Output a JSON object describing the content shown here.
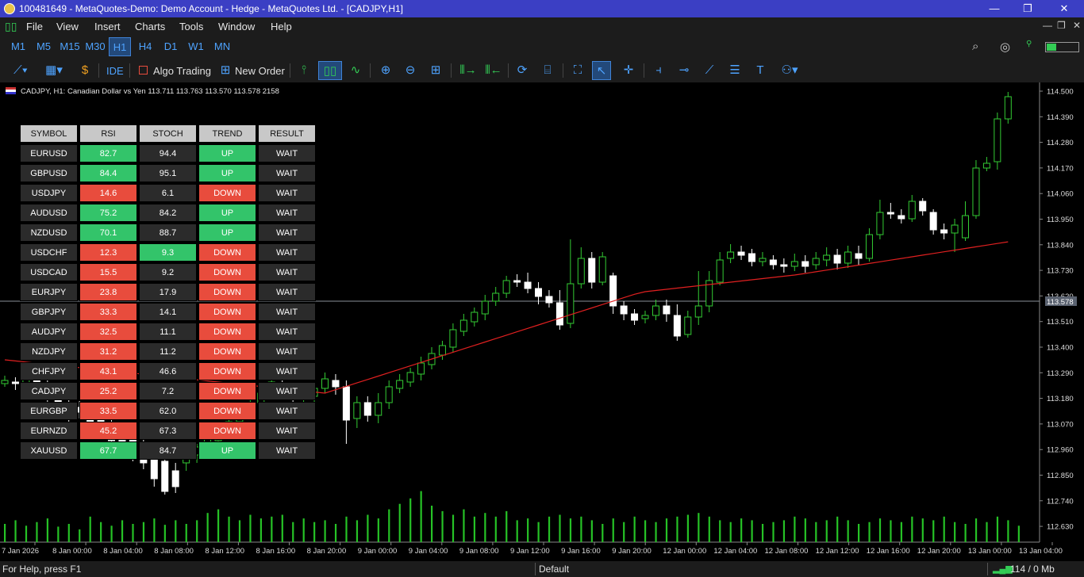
{
  "window": {
    "title": "100481649 - MetaQuotes-Demo: Demo Account - Hedge - MetaQuotes Ltd. - [CADJPY,H1]",
    "minimize": "—",
    "maximize": "❐",
    "close": "✕"
  },
  "menu": {
    "items": [
      "File",
      "View",
      "Insert",
      "Charts",
      "Tools",
      "Window",
      "Help"
    ]
  },
  "timeframes": {
    "items": [
      "M1",
      "M5",
      "M15",
      "M30",
      "H1",
      "H4",
      "D1",
      "W1",
      "MN"
    ],
    "active": "H1"
  },
  "toolbar": {
    "ide": "IDE",
    "algo_trading": "Algo Trading",
    "new_order": "New Order"
  },
  "chart": {
    "info": "CADJPY, H1:  Canadian Dollar vs Yen  113.711 113.763 113.570 113.578  2158",
    "current_price": "113.578",
    "y_ticks": [
      "114.500",
      "114.390",
      "114.280",
      "114.170",
      "114.060",
      "113.950",
      "113.840",
      "113.730",
      "113.620",
      "113.510",
      "113.400",
      "113.290",
      "113.180",
      "113.070",
      "112.960",
      "112.850",
      "112.740",
      "112.630"
    ],
    "x_ticks": [
      "7 Jan 2026",
      "8 Jan 00:00",
      "8 Jan 04:00",
      "8 Jan 08:00",
      "8 Jan 12:00",
      "8 Jan 16:00",
      "8 Jan 20:00",
      "9 Jan 00:00",
      "9 Jan 04:00",
      "9 Jan 08:00",
      "9 Jan 12:00",
      "9 Jan 16:00",
      "9 Jan 20:00",
      "12 Jan 00:00",
      "12 Jan 04:00",
      "12 Jan 08:00",
      "12 Jan 12:00",
      "12 Jan 16:00",
      "12 Jan 20:00",
      "13 Jan 00:00",
      "13 Jan 04:00"
    ],
    "colors": {
      "bull": "#33cc33",
      "bear": "#ffffff",
      "ma": "#e02020",
      "volume": "#26c226",
      "grid": "#555555"
    }
  },
  "dashboard": {
    "headers": [
      "SYMBOL",
      "RSI",
      "STOCH",
      "TREND",
      "RESULT"
    ],
    "rows": [
      [
        "EURUSD",
        "82.7",
        "94.4",
        "UP",
        "WAIT"
      ],
      [
        "GBPUSD",
        "84.4",
        "95.1",
        "UP",
        "WAIT"
      ],
      [
        "USDJPY",
        "14.6",
        "6.1",
        "DOWN",
        "WAIT"
      ],
      [
        "AUDUSD",
        "75.2",
        "84.2",
        "UP",
        "WAIT"
      ],
      [
        "NZDUSD",
        "70.1",
        "88.7",
        "UP",
        "WAIT"
      ],
      [
        "USDCHF",
        "12.3",
        "9.3",
        "DOWN",
        "WAIT"
      ],
      [
        "USDCAD",
        "15.5",
        "9.2",
        "DOWN",
        "WAIT"
      ],
      [
        "EURJPY",
        "23.8",
        "17.9",
        "DOWN",
        "WAIT"
      ],
      [
        "GBPJPY",
        "33.3",
        "14.1",
        "DOWN",
        "WAIT"
      ],
      [
        "AUDJPY",
        "32.5",
        "11.1",
        "DOWN",
        "WAIT"
      ],
      [
        "NZDJPY",
        "31.2",
        "11.2",
        "DOWN",
        "WAIT"
      ],
      [
        "CHFJPY",
        "43.1",
        "46.6",
        "DOWN",
        "WAIT"
      ],
      [
        "CADJPY",
        "25.2",
        "7.2",
        "DOWN",
        "WAIT"
      ],
      [
        "EURGBP",
        "33.5",
        "62.0",
        "DOWN",
        "WAIT"
      ],
      [
        "EURNZD",
        "45.2",
        "67.3",
        "DOWN",
        "WAIT"
      ],
      [
        "XAUUSD",
        "67.7",
        "84.7",
        "UP",
        "WAIT"
      ]
    ],
    "cell_colors": [
      [
        "n",
        "g",
        "n",
        "g",
        "n"
      ],
      [
        "n",
        "g",
        "n",
        "g",
        "n"
      ],
      [
        "n",
        "r",
        "n",
        "r",
        "n"
      ],
      [
        "n",
        "g",
        "n",
        "g",
        "n"
      ],
      [
        "n",
        "g",
        "n",
        "g",
        "n"
      ],
      [
        "n",
        "r",
        "g",
        "r",
        "n"
      ],
      [
        "n",
        "r",
        "n",
        "r",
        "n"
      ],
      [
        "n",
        "r",
        "n",
        "r",
        "n"
      ],
      [
        "n",
        "r",
        "n",
        "r",
        "n"
      ],
      [
        "n",
        "r",
        "n",
        "r",
        "n"
      ],
      [
        "n",
        "r",
        "n",
        "r",
        "n"
      ],
      [
        "n",
        "r",
        "n",
        "r",
        "n"
      ],
      [
        "n",
        "r",
        "n",
        "r",
        "n"
      ],
      [
        "n",
        "r",
        "n",
        "r",
        "n"
      ],
      [
        "n",
        "r",
        "n",
        "r",
        "n"
      ],
      [
        "n",
        "g",
        "n",
        "g",
        "n"
      ]
    ]
  },
  "status": {
    "help": "For Help, press F1",
    "profile": "Default",
    "traffic": "114 / 0 Mb"
  }
}
